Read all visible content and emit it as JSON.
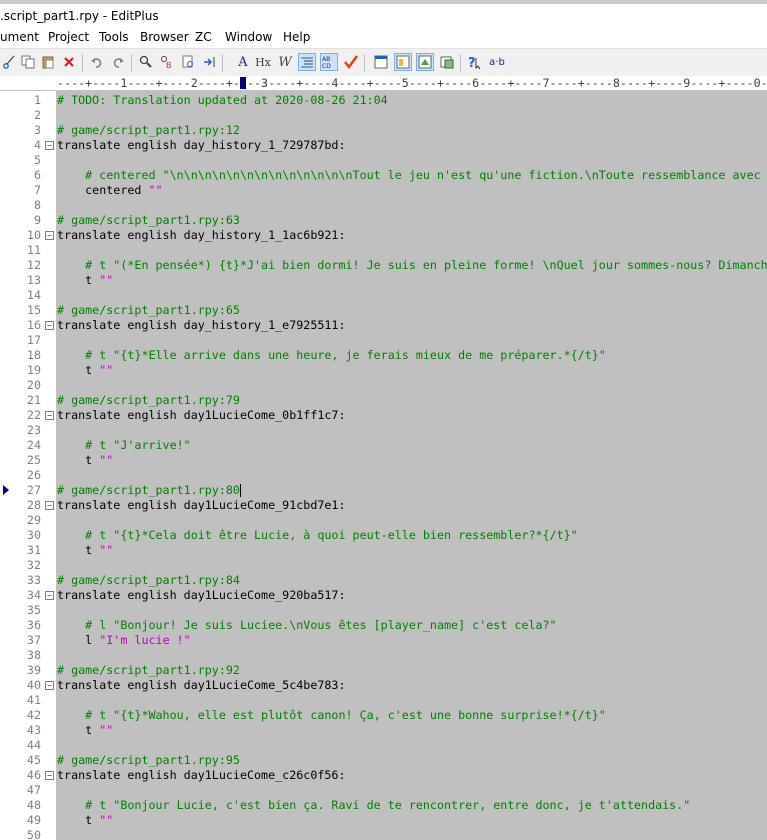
{
  "window": {
    "title": ".script_part1.rpy - EditPlus"
  },
  "menu": [
    {
      "label": "ument"
    },
    {
      "label": "Project"
    },
    {
      "label": "Tools"
    },
    {
      "label": "Browser"
    },
    {
      "label": "ZC"
    },
    {
      "label": "Window"
    },
    {
      "label": "Help"
    }
  ],
  "toolbar": {
    "icons": [
      "scissors-icon",
      "copy-icon",
      "paste-icon",
      "delete-icon",
      "undo-icon",
      "redo-icon",
      "find-icon",
      "replace-icon",
      "find-in-files-icon",
      "goto-icon",
      "font-icon",
      "hex-icon",
      "word-wrap-icon",
      "line-number-icon",
      "spell-abc-icon",
      "check-icon",
      "browser-icon",
      "output-window-icon",
      "directory-icon",
      "cliptext-icon",
      "help-icon",
      "ab-icon"
    ],
    "labels": {
      "font": "A",
      "hex": "Hx",
      "wrap": "W",
      "ab": "a·b"
    }
  },
  "ruler": {
    "text": "----+----1----+----2----+----3----+----4----+----5----+----6----+----7----+----8----+----9----+----0----"
  },
  "editor": {
    "current_line": 27,
    "lines": [
      {
        "n": "1",
        "t": "# TODO: Translation updated at 2020-08-26 21:04",
        "k": "comment"
      },
      {
        "n": "2",
        "t": "",
        "k": "code"
      },
      {
        "n": "3",
        "t": "# game/script_part1.rpy:12",
        "k": "comment"
      },
      {
        "n": "4",
        "t": "translate english day_history_1_729787bd:",
        "k": "code",
        "fold": true
      },
      {
        "n": "5",
        "t": "",
        "k": "code"
      },
      {
        "n": "6",
        "t": "    # centered \"\\n\\n\\n\\n\\n\\n\\n\\n\\n\\n\\n\\n\\nTout le jeu n'est qu'une fiction.\\nToute ressemblance avec des",
        "k": "comment"
      },
      {
        "n": "7",
        "t": "    centered ",
        "s": "\"\"",
        "k": "code"
      },
      {
        "n": "8",
        "t": "",
        "k": "code"
      },
      {
        "n": "9",
        "t": "# game/script_part1.rpy:63",
        "k": "comment"
      },
      {
        "n": "10",
        "t": "translate english day_history_1_1ac6b921:",
        "k": "code",
        "fold": true
      },
      {
        "n": "11",
        "t": "",
        "k": "code"
      },
      {
        "n": "12",
        "t": "    # t \"(*En pensée*) {t}*J'ai bien dormi! Je suis en pleine forme! \\nQuel jour sommes-nous? Dimanche",
        "k": "comment"
      },
      {
        "n": "13",
        "t": "    t ",
        "s": "\"\"",
        "k": "code"
      },
      {
        "n": "14",
        "t": "",
        "k": "code"
      },
      {
        "n": "15",
        "t": "# game/script_part1.rpy:65",
        "k": "comment"
      },
      {
        "n": "16",
        "t": "translate english day_history_1_e7925511:",
        "k": "code",
        "fold": true
      },
      {
        "n": "17",
        "t": "",
        "k": "code"
      },
      {
        "n": "18",
        "t": "    # t \"{t}*Elle arrive dans une heure, je ferais mieux de me préparer.*{/t}\"",
        "k": "comment"
      },
      {
        "n": "19",
        "t": "    t ",
        "s": "\"\"",
        "k": "code"
      },
      {
        "n": "20",
        "t": "",
        "k": "code"
      },
      {
        "n": "21",
        "t": "# game/script_part1.rpy:79",
        "k": "comment"
      },
      {
        "n": "22",
        "t": "translate english day1LucieCome_0b1ff1c7:",
        "k": "code",
        "fold": true
      },
      {
        "n": "23",
        "t": "",
        "k": "code"
      },
      {
        "n": "24",
        "t": "    # t \"J'arrive!\"",
        "k": "comment"
      },
      {
        "n": "25",
        "t": "    t ",
        "s": "\"\"",
        "k": "code"
      },
      {
        "n": "26",
        "t": "",
        "k": "code"
      },
      {
        "n": "27",
        "t": "# game/script_part1.rpy:80",
        "k": "comment"
      },
      {
        "n": "28",
        "t": "translate english day1LucieCome_91cbd7e1:",
        "k": "code",
        "fold": true
      },
      {
        "n": "29",
        "t": "",
        "k": "code"
      },
      {
        "n": "30",
        "t": "    # t \"{t}*Cela doit être Lucie, à quoi peut-elle bien ressembler?*{/t}\"",
        "k": "comment"
      },
      {
        "n": "31",
        "t": "    t ",
        "s": "\"\"",
        "k": "code"
      },
      {
        "n": "32",
        "t": "",
        "k": "code"
      },
      {
        "n": "33",
        "t": "# game/script_part1.rpy:84",
        "k": "comment"
      },
      {
        "n": "34",
        "t": "translate english day1LucieCome_920ba517:",
        "k": "code",
        "fold": true
      },
      {
        "n": "35",
        "t": "",
        "k": "code"
      },
      {
        "n": "36",
        "t": "    # l \"Bonjour! Je suis Luciee.\\nVous êtes [player_name] c'est cela?\"",
        "k": "comment"
      },
      {
        "n": "37",
        "t": "    l ",
        "s": "\"I'm lucie !\"",
        "k": "code"
      },
      {
        "n": "38",
        "t": "",
        "k": "code"
      },
      {
        "n": "39",
        "t": "# game/script_part1.rpy:92",
        "k": "comment"
      },
      {
        "n": "40",
        "t": "translate english day1LucieCome_5c4be783:",
        "k": "code",
        "fold": true
      },
      {
        "n": "41",
        "t": "",
        "k": "code"
      },
      {
        "n": "42",
        "t": "    # t \"{t}*Wahou, elle est plutôt canon! Ça, c'est une bonne surprise!*{/t}\"",
        "k": "comment"
      },
      {
        "n": "43",
        "t": "    t ",
        "s": "\"\"",
        "k": "code"
      },
      {
        "n": "44",
        "t": "",
        "k": "code"
      },
      {
        "n": "45",
        "t": "# game/script_part1.rpy:95",
        "k": "comment"
      },
      {
        "n": "46",
        "t": "translate english day1LucieCome_c26c0f56:",
        "k": "code",
        "fold": true
      },
      {
        "n": "47",
        "t": "",
        "k": "code"
      },
      {
        "n": "48",
        "t": "    # t \"Bonjour Lucie, c'est bien ça. Ravi de te rencontrer, entre donc, je t'attendais.\"",
        "k": "comment"
      },
      {
        "n": "49",
        "t": "    t ",
        "s": "\"\"",
        "k": "code"
      },
      {
        "n": "50",
        "t": "",
        "k": "code"
      }
    ]
  },
  "colors": {
    "comment": "#008000",
    "string": "#c000c0",
    "editor_bg": "#c0c0c0",
    "gutter_bg": "#ffffff",
    "marker": "#000080"
  }
}
